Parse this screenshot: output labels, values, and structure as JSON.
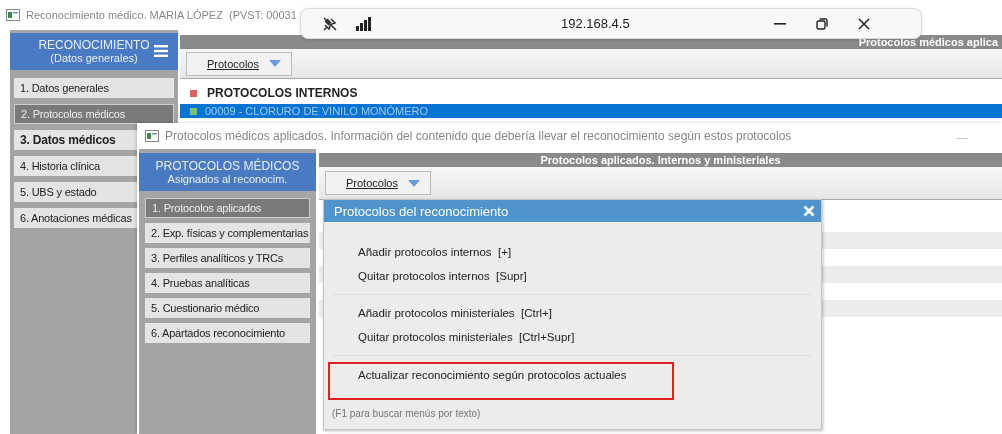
{
  "back_window": {
    "title": "Reconocimiento médico. MARIA LÓPEZ  (PVST: 00031",
    "sidebar": {
      "title": "RECONOCIMIENTO",
      "subtitle": "(Datos generales)",
      "items": [
        {
          "label": "1. Datos generales",
          "selected": false,
          "current": false
        },
        {
          "label": "2. Protocolos médicos",
          "selected": true,
          "current": false
        },
        {
          "label": "3. Datos médicos",
          "selected": false,
          "current": true
        },
        {
          "label": "4. Historia clínica",
          "selected": false,
          "current": false
        },
        {
          "label": "5. UBS y estado",
          "selected": false,
          "current": false
        },
        {
          "label": "6. Anotaciones médicas",
          "selected": false,
          "current": false
        }
      ]
    },
    "header": "Protocolos médicos aplica",
    "toolbar_button": "Protocolos",
    "section_title": "PROTOCOLOS INTERNOS",
    "rows": [
      {
        "label": "00009 - CLORURO DE VINILO MONÓMERO",
        "selected": true
      }
    ]
  },
  "remote_bar": {
    "address": "192.168.4.5"
  },
  "front_window": {
    "title": "Protocolos médicos aplicados. Información del contenido que debería llevar el reconocimiento según estos protocolos",
    "sidebar": {
      "title": "PROTOCOLOS MÉDICOS",
      "subtitle": "Asignados al reconocim.",
      "items": [
        {
          "label": "1. Protocolos aplicados",
          "selected": true
        },
        {
          "label": "2. Exp. físicas y complementarias",
          "selected": false
        },
        {
          "label": "3. Perfiles analíticos y TRCs",
          "selected": false
        },
        {
          "label": "4. Pruebas analíticas",
          "selected": false
        },
        {
          "label": "5. Cuestionario médico",
          "selected": false
        },
        {
          "label": "6. Apartados reconocimiento",
          "selected": false
        }
      ]
    },
    "header": "Protocolos aplicados. Internos y ministeriales",
    "toolbar_button": "Protocolos",
    "menu": {
      "title": "Protocolos del reconocimiento",
      "groups": [
        [
          {
            "label": "Añadir protocolos internos  [+]",
            "highlighted": false
          },
          {
            "label": "Quitar protocolos internos  [Supr]",
            "highlighted": false
          }
        ],
        [
          {
            "label": "Añadir protocolos ministeriales  [Ctrl+]",
            "highlighted": false
          },
          {
            "label": "Quitar protocolos ministeriales  [Ctrl+Supr]",
            "highlighted": false
          }
        ],
        [
          {
            "label": "Actualizar reconocimiento según protocolos actuales",
            "highlighted": true
          }
        ]
      ],
      "hint": "(F1 para buscar menús por texto)"
    }
  }
}
